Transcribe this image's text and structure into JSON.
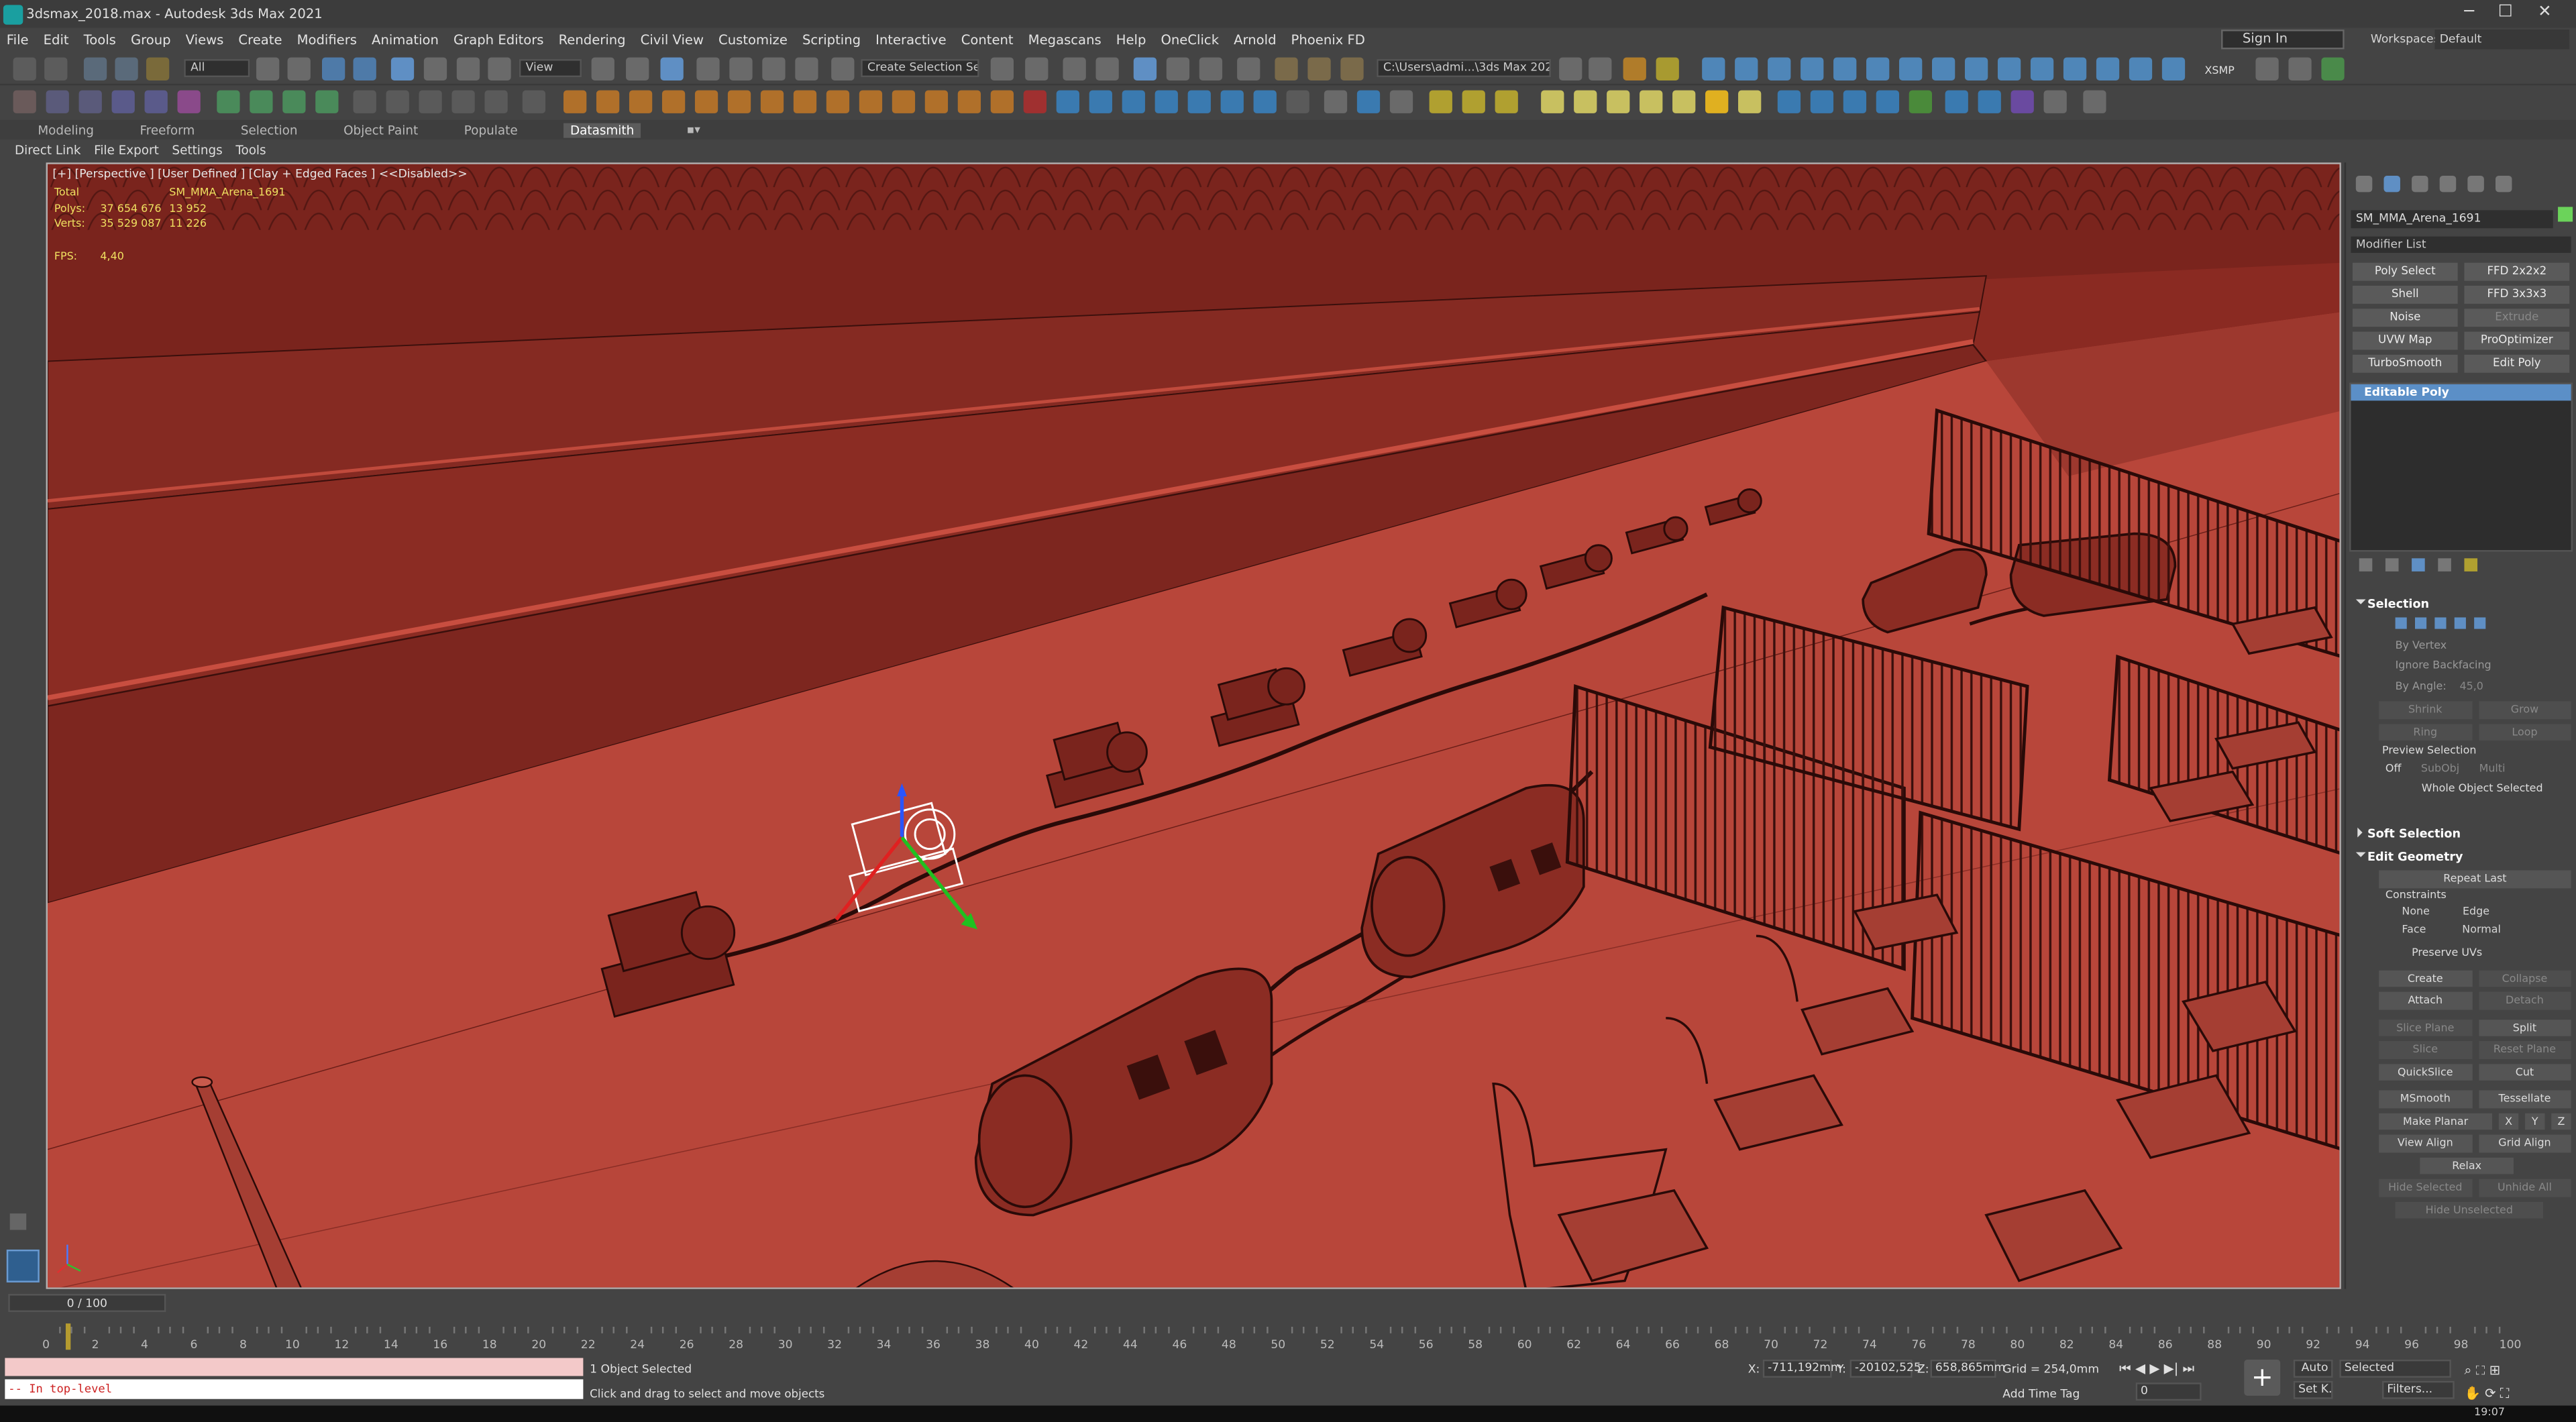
{
  "window": {
    "title": "3dsmax_2018.max - Autodesk 3ds Max 2021",
    "minimize": "─",
    "maximize": "☐",
    "close": "✕"
  },
  "menu": [
    "File",
    "Edit",
    "Tools",
    "Group",
    "Views",
    "Create",
    "Modifiers",
    "Animation",
    "Graph Editors",
    "Rendering",
    "Civil View",
    "Customize",
    "Scripting",
    "Interactive",
    "Content",
    "Megascans",
    "Help",
    "OneClick",
    "Arnold",
    "Phoenix FD"
  ],
  "account": {
    "sign_in": "Sign In",
    "workspaces_label": "Workspaces:",
    "workspace_value": "Default"
  },
  "toolbar": {
    "filter": "All",
    "ref_coord": "View",
    "selection_set": "Create Selection Set",
    "project_path": "C:\\Users\\admi...\\3ds Max 2021",
    "xsmp": "XSMP"
  },
  "ribbon_tabs": [
    "Modeling",
    "Freeform",
    "Selection",
    "Object Paint",
    "Populate",
    "Datasmith"
  ],
  "ribbon_active": "Datasmith",
  "sub_tabs": [
    "Direct Link",
    "File Export",
    "Settings",
    "Tools"
  ],
  "viewport": {
    "label": "[+] [Perspective ] [User Defined ] [Clay + Edged Faces ]  <<Disabled>>",
    "stats": {
      "total_label": "Total",
      "object_name": "SM_MMA_Arena_1691",
      "polys_label": "Polys:",
      "polys_total": "37 654 676",
      "polys_sel": "13 952",
      "verts_label": "Verts:",
      "verts_total": "35 529 087",
      "verts_sel": "11 226",
      "fps_label": "FPS:",
      "fps_value": "4,40"
    },
    "clay_color": "#8b2a22"
  },
  "command_panel": {
    "object_name": "SM_MMA_Arena_1691",
    "modifier_list": "Modifier List",
    "modifier_buttons": [
      "Poly Select",
      "FFD 2x2x2",
      "Shell",
      "FFD 3x3x3",
      "Noise",
      "Extrude",
      "UVW Map",
      "ProOptimizer",
      "TurboSmooth",
      "Edit Poly"
    ],
    "stack_selected": "Editable Poly",
    "selection": {
      "title": "Selection",
      "by_vertex": "By Vertex",
      "ignore_backfacing": "Ignore Backfacing",
      "by_angle": "By Angle:",
      "angle_value": "45,0",
      "shrink": "Shrink",
      "grow": "Grow",
      "ring": "Ring",
      "loop": "Loop",
      "preview_selection": "Preview Selection",
      "off": "Off",
      "subobj": "SubObj",
      "multi": "Multi",
      "whole_object": "Whole Object Selected"
    },
    "soft_selection": "Soft Selection",
    "edit_geometry": {
      "title": "Edit Geometry",
      "repeat_last": "Repeat Last",
      "constraints": "Constraints",
      "none": "None",
      "edge": "Edge",
      "face": "Face",
      "normal": "Normal",
      "preserve_uvs": "Preserve UVs",
      "create": "Create",
      "collapse": "Collapse",
      "attach": "Attach",
      "detach": "Detach",
      "slice_plane": "Slice Plane",
      "split": "Split",
      "slice": "Slice",
      "reset_plane": "Reset Plane",
      "quickslice": "QuickSlice",
      "cut": "Cut",
      "msmooth": "MSmooth",
      "tessellate": "Tessellate",
      "make_planar": "Make Planar",
      "x": "X",
      "y": "Y",
      "z": "Z",
      "view_align": "View Align",
      "grid_align": "Grid Align",
      "relax": "Relax",
      "hide_selected": "Hide Selected",
      "unhide_all": "Unhide All",
      "hide_unselected": "Hide Unselected"
    }
  },
  "timeline": {
    "slider_label": "0 / 100",
    "ticks": [
      "0",
      "2",
      "4",
      "6",
      "8",
      "10",
      "12",
      "14",
      "16",
      "18",
      "20",
      "22",
      "24",
      "26",
      "28",
      "30",
      "32",
      "34",
      "36",
      "38",
      "40",
      "42",
      "44",
      "46",
      "48",
      "50",
      "52",
      "54",
      "56",
      "58",
      "60",
      "62",
      "64",
      "66",
      "68",
      "70",
      "72",
      "74",
      "76",
      "78",
      "80",
      "82",
      "84",
      "86",
      "88",
      "90",
      "92",
      "94",
      "96",
      "98",
      "100"
    ]
  },
  "status": {
    "maxscript_line1": "",
    "maxscript_line2": "-- In top-level",
    "selected": "1 Object Selected",
    "prompt": "Click and drag to select and move objects",
    "x_label": "X:",
    "x_value": "-711,192mm",
    "y_label": "Y:",
    "y_value": "-20102,525",
    "z_label": "Z:",
    "z_value": "658,865mm",
    "grid": "Grid = 254,0mm",
    "add_time_tag": "Add Time Tag",
    "auto": "Auto",
    "selected_dd": "Selected",
    "set_k": "Set K.",
    "filters": "Filters...",
    "frame_value": "0",
    "clock": "19:07"
  }
}
